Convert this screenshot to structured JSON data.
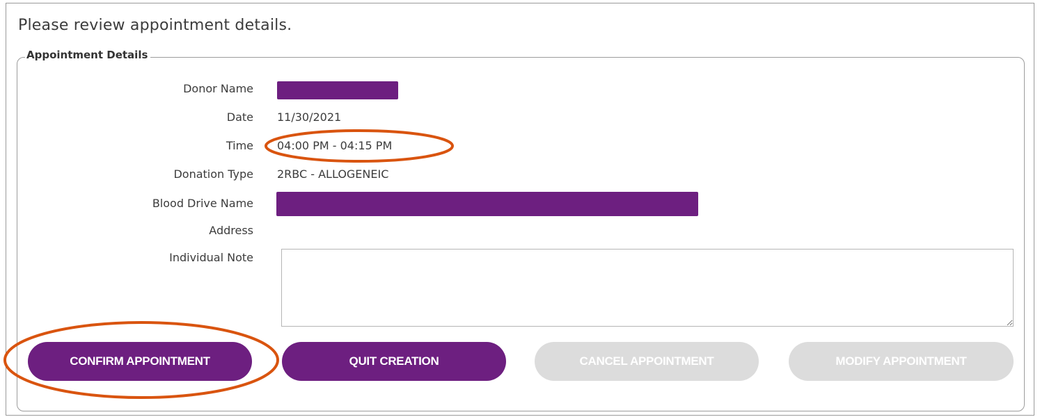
{
  "prompt": "Please review appointment details.",
  "section_title": "Appointment Details",
  "fields": {
    "donor_name": {
      "label": "Donor Name",
      "value": ""
    },
    "date": {
      "label": "Date",
      "value": "11/30/2021"
    },
    "time": {
      "label": "Time",
      "value": "04:00 PM - 04:15 PM"
    },
    "donation_type": {
      "label": "Donation Type",
      "value": "2RBC - ALLOGENEIC"
    },
    "blood_drive_name": {
      "label": "Blood Drive Name",
      "value": ""
    },
    "address": {
      "label": "Address",
      "value": ""
    },
    "individual_note": {
      "label": "Individual Note",
      "value": ""
    }
  },
  "buttons": {
    "confirm": "CONFIRM APPOINTMENT",
    "quit": "QUIT CREATION",
    "cancel": "CANCEL APPOINTMENT",
    "modify": "MODIFY APPOINTMENT"
  },
  "colors": {
    "brand_purple": "#6d1f80",
    "disabled_gray": "#dcdcdc",
    "annotation_orange": "#d9540f"
  }
}
